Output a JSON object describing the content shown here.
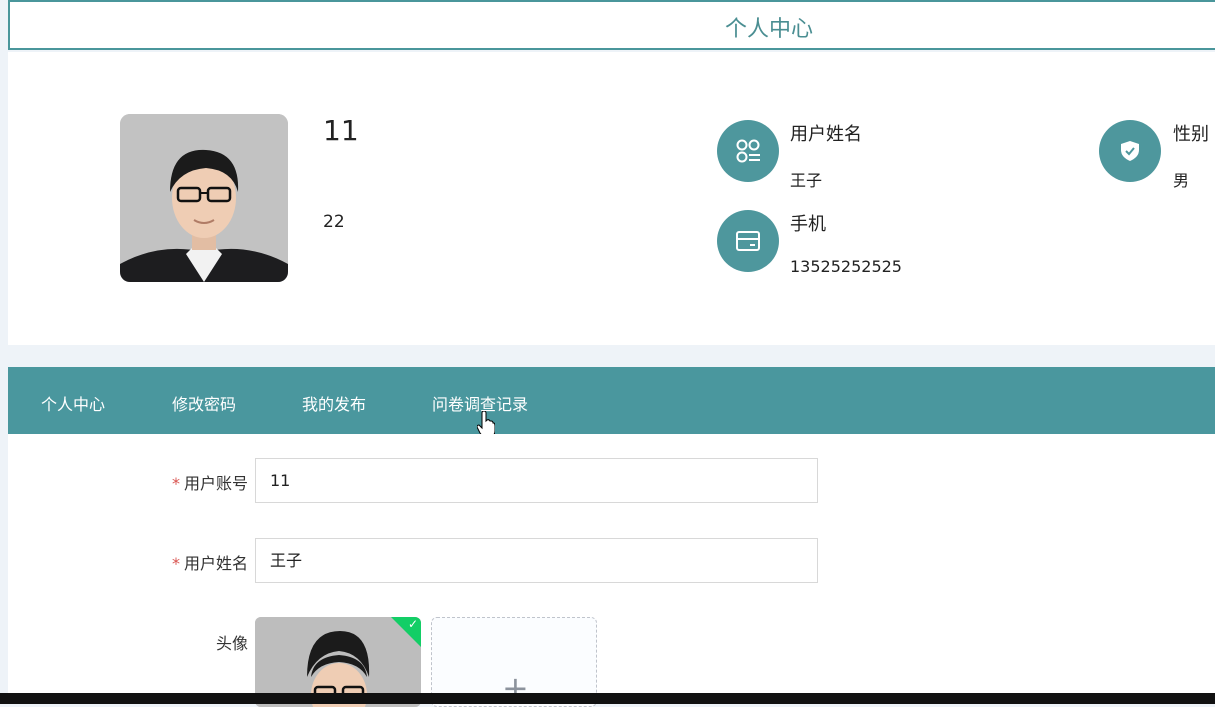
{
  "header": {
    "title": "个人中心"
  },
  "profile": {
    "name": "11",
    "age": "22",
    "fields": [
      {
        "label": "用户姓名",
        "value": "王子",
        "icon": "apps-icon"
      },
      {
        "label": "性别",
        "value": "男",
        "icon": "shield-check-icon"
      },
      {
        "label": "手机",
        "value": "13525252525",
        "icon": "card-icon"
      }
    ]
  },
  "tabs": [
    {
      "label": "个人中心"
    },
    {
      "label": "修改密码"
    },
    {
      "label": "我的发布"
    },
    {
      "label": "问卷调查记录"
    }
  ],
  "form": {
    "account": {
      "label": "用户账号",
      "value": "11",
      "required": "*"
    },
    "username": {
      "label": "用户姓名",
      "value": "王子",
      "required": "*"
    },
    "avatar": {
      "label": "头像",
      "upload_icon": "+"
    }
  },
  "colors": {
    "accent": "#4a979e",
    "required": "#d9534f",
    "success": "#13ce66"
  }
}
